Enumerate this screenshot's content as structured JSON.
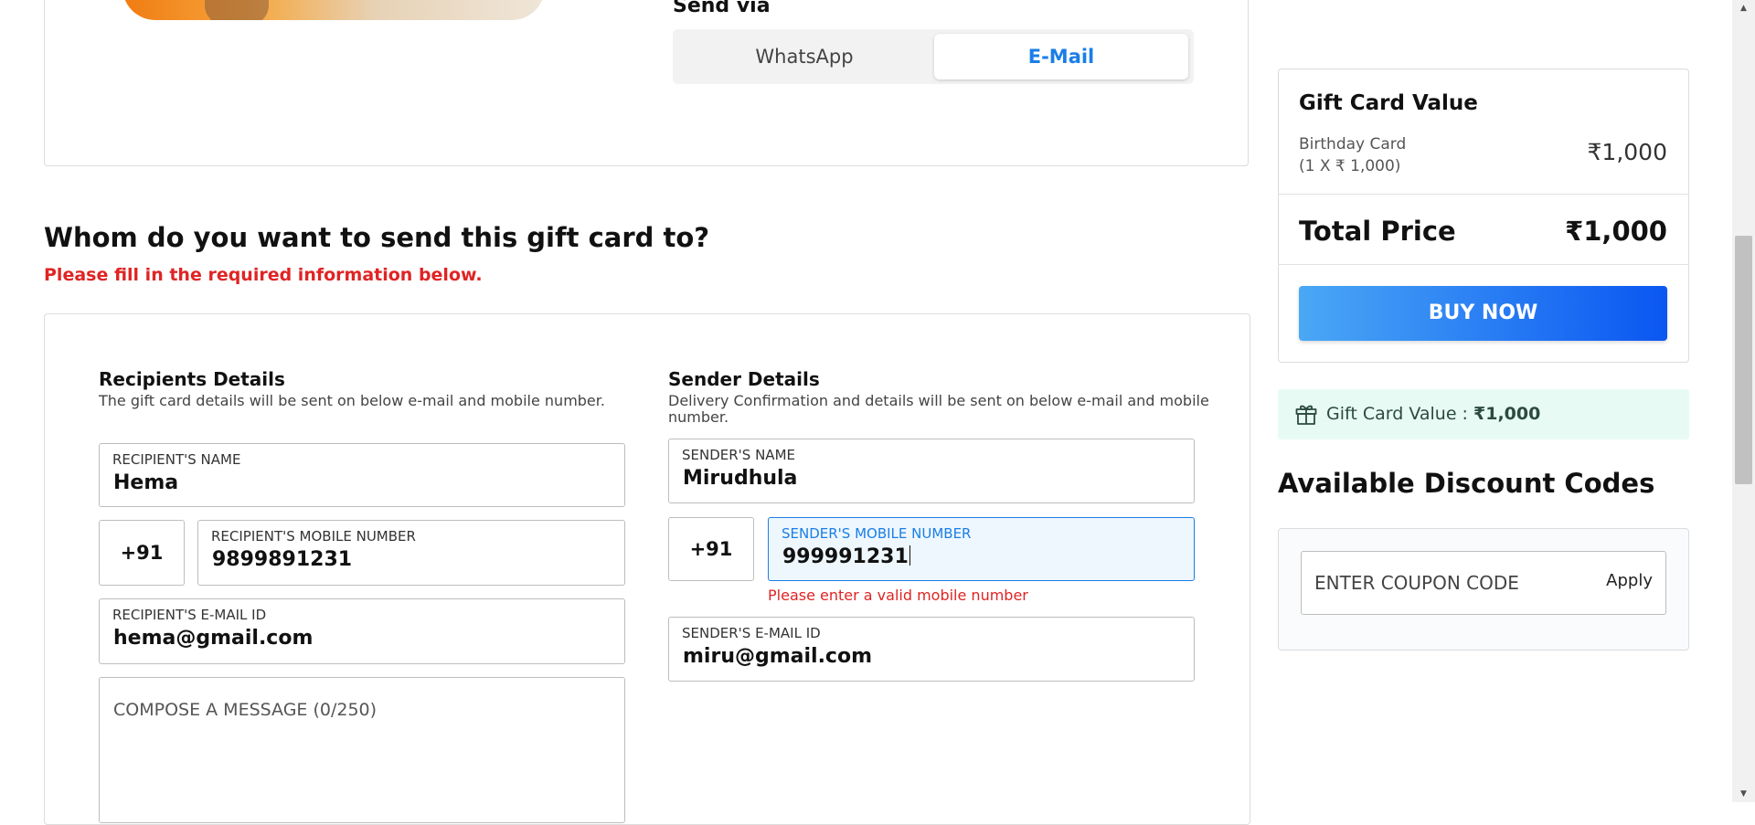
{
  "send_via": {
    "label": "Send via",
    "options": [
      {
        "label": "WhatsApp",
        "selected": false
      },
      {
        "label": "E-Mail",
        "selected": true
      }
    ]
  },
  "heading": "Whom do you want to send this gift card to?",
  "required_notice": "Please fill in the required information below.",
  "recipient": {
    "title": "Recipients Details",
    "subtitle": "The gift card details will be sent on below e-mail and mobile number.",
    "name_label": "RECIPIENT'S NAME",
    "name_value": "Hema",
    "country_code": "+91",
    "mobile_label": "RECIPIENT'S MOBILE NUMBER",
    "mobile_value": "9899891231",
    "email_label": "RECIPIENT'S E-MAIL ID",
    "email_value": "hema@gmail.com",
    "message_placeholder": "COMPOSE A MESSAGE (0/250)"
  },
  "sender": {
    "title": "Sender Details",
    "subtitle_line1": "Delivery Confirmation and details will be sent on below e-mail and mobile",
    "subtitle_line2": "number.",
    "name_label": "SENDER'S NAME",
    "name_value": "Mirudhula",
    "country_code": "+91",
    "mobile_label": "SENDER'S MOBILE NUMBER",
    "mobile_value": "999991231",
    "mobile_error": "Please enter a valid mobile number",
    "email_label": "SENDER'S E-MAIL ID",
    "email_value": "miru@gmail.com"
  },
  "summary": {
    "title": "Gift Card Value",
    "item_name": "Birthday Card",
    "item_detail": "(1 X ₹ 1,000)",
    "item_amount": "₹1,000",
    "total_label": "Total Price",
    "total_amount": "₹1,000",
    "buy_label": "BUY NOW"
  },
  "gift_value_bar": {
    "label": "Gift Card Value : ",
    "amount": "₹1,000",
    "icon": "gift-icon"
  },
  "discounts": {
    "title": "Available Discount Codes",
    "coupon_placeholder": "ENTER COUPON CODE",
    "apply_label": "Apply"
  },
  "colors": {
    "accent_blue": "#1a7ee6",
    "error_red": "#e02424",
    "buy_gradient_start": "#4aa8f5",
    "buy_gradient_end": "#0b56f2",
    "gift_bar_bg": "#e7fbf4"
  }
}
